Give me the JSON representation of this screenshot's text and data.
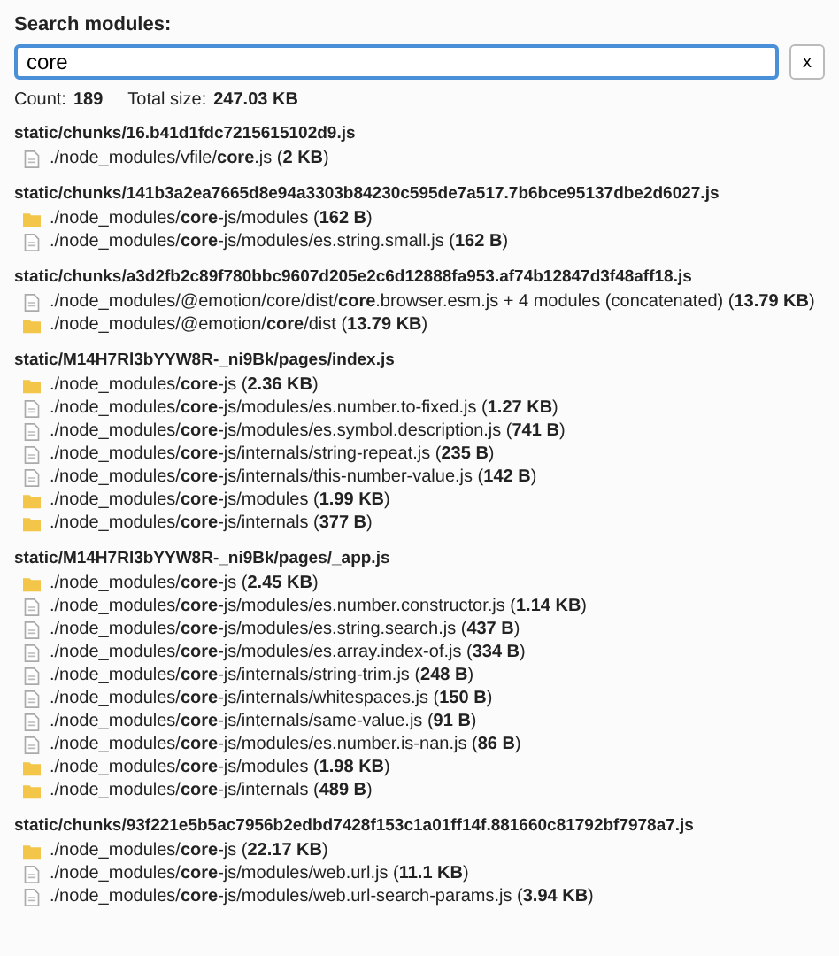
{
  "search": {
    "label": "Search modules:",
    "value": "core",
    "clear": "x"
  },
  "summary": {
    "count_label": "Count:",
    "count": "189",
    "size_label": "Total size:",
    "size": "247.03 KB"
  },
  "chunks": [
    {
      "name": "static/chunks/16.b41d1fdc7215615102d9.js",
      "modules": [
        {
          "kind": "file",
          "text": "./node_modules/vfile/**core**.js (**2 KB**)"
        }
      ]
    },
    {
      "name": "static/chunks/141b3a2ea7665d8e94a3303b84230c595de7a517.7b6bce95137dbe2d6027.js",
      "modules": [
        {
          "kind": "folder",
          "text": "./node_modules/**core**-js/modules (**162 B**)"
        },
        {
          "kind": "file",
          "text": "./node_modules/**core**-js/modules/es.string.small.js (**162 B**)"
        }
      ]
    },
    {
      "name": "static/chunks/a3d2fb2c89f780bbc9607d205e2c6d12888fa953.af74b12847d3f48aff18.js",
      "modules": [
        {
          "kind": "file",
          "text": "./node_modules/@emotion/core/dist/**core**.browser.esm.js + 4 modules (concatenated) (**13.79 KB**)"
        },
        {
          "kind": "folder",
          "text": "./node_modules/@emotion/**core**/dist (**13.79 KB**)"
        }
      ]
    },
    {
      "name": "static/M14H7Rl3bYYW8R-_ni9Bk/pages/index.js",
      "modules": [
        {
          "kind": "folder",
          "text": "./node_modules/**core**-js (**2.36 KB**)"
        },
        {
          "kind": "file",
          "text": "./node_modules/**core**-js/modules/es.number.to-fixed.js (**1.27 KB**)"
        },
        {
          "kind": "file",
          "text": "./node_modules/**core**-js/modules/es.symbol.description.js (**741 B**)"
        },
        {
          "kind": "file",
          "text": "./node_modules/**core**-js/internals/string-repeat.js (**235 B**)"
        },
        {
          "kind": "file",
          "text": "./node_modules/**core**-js/internals/this-number-value.js (**142 B**)"
        },
        {
          "kind": "folder",
          "text": "./node_modules/**core**-js/modules (**1.99 KB**)"
        },
        {
          "kind": "folder",
          "text": "./node_modules/**core**-js/internals (**377 B**)"
        }
      ]
    },
    {
      "name": "static/M14H7Rl3bYYW8R-_ni9Bk/pages/_app.js",
      "modules": [
        {
          "kind": "folder",
          "text": "./node_modules/**core**-js (**2.45 KB**)"
        },
        {
          "kind": "file",
          "text": "./node_modules/**core**-js/modules/es.number.constructor.js (**1.14 KB**)"
        },
        {
          "kind": "file",
          "text": "./node_modules/**core**-js/modules/es.string.search.js (**437 B**)"
        },
        {
          "kind": "file",
          "text": "./node_modules/**core**-js/modules/es.array.index-of.js (**334 B**)"
        },
        {
          "kind": "file",
          "text": "./node_modules/**core**-js/internals/string-trim.js (**248 B**)"
        },
        {
          "kind": "file",
          "text": "./node_modules/**core**-js/internals/whitespaces.js (**150 B**)"
        },
        {
          "kind": "file",
          "text": "./node_modules/**core**-js/internals/same-value.js (**91 B**)"
        },
        {
          "kind": "file",
          "text": "./node_modules/**core**-js/modules/es.number.is-nan.js (**86 B**)"
        },
        {
          "kind": "folder",
          "text": "./node_modules/**core**-js/modules (**1.98 KB**)"
        },
        {
          "kind": "folder",
          "text": "./node_modules/**core**-js/internals (**489 B**)"
        }
      ]
    },
    {
      "name": "static/chunks/93f221e5b5ac7956b2edbd7428f153c1a01ff14f.881660c81792bf7978a7.js",
      "modules": [
        {
          "kind": "folder",
          "text": "./node_modules/**core**-js (**22.17 KB**)"
        },
        {
          "kind": "file",
          "text": "./node_modules/**core**-js/modules/web.url.js (**11.1 KB**)"
        },
        {
          "kind": "file",
          "text": "./node_modules/**core**-js/modules/web.url-search-params.js (**3.94 KB**)"
        }
      ]
    }
  ]
}
